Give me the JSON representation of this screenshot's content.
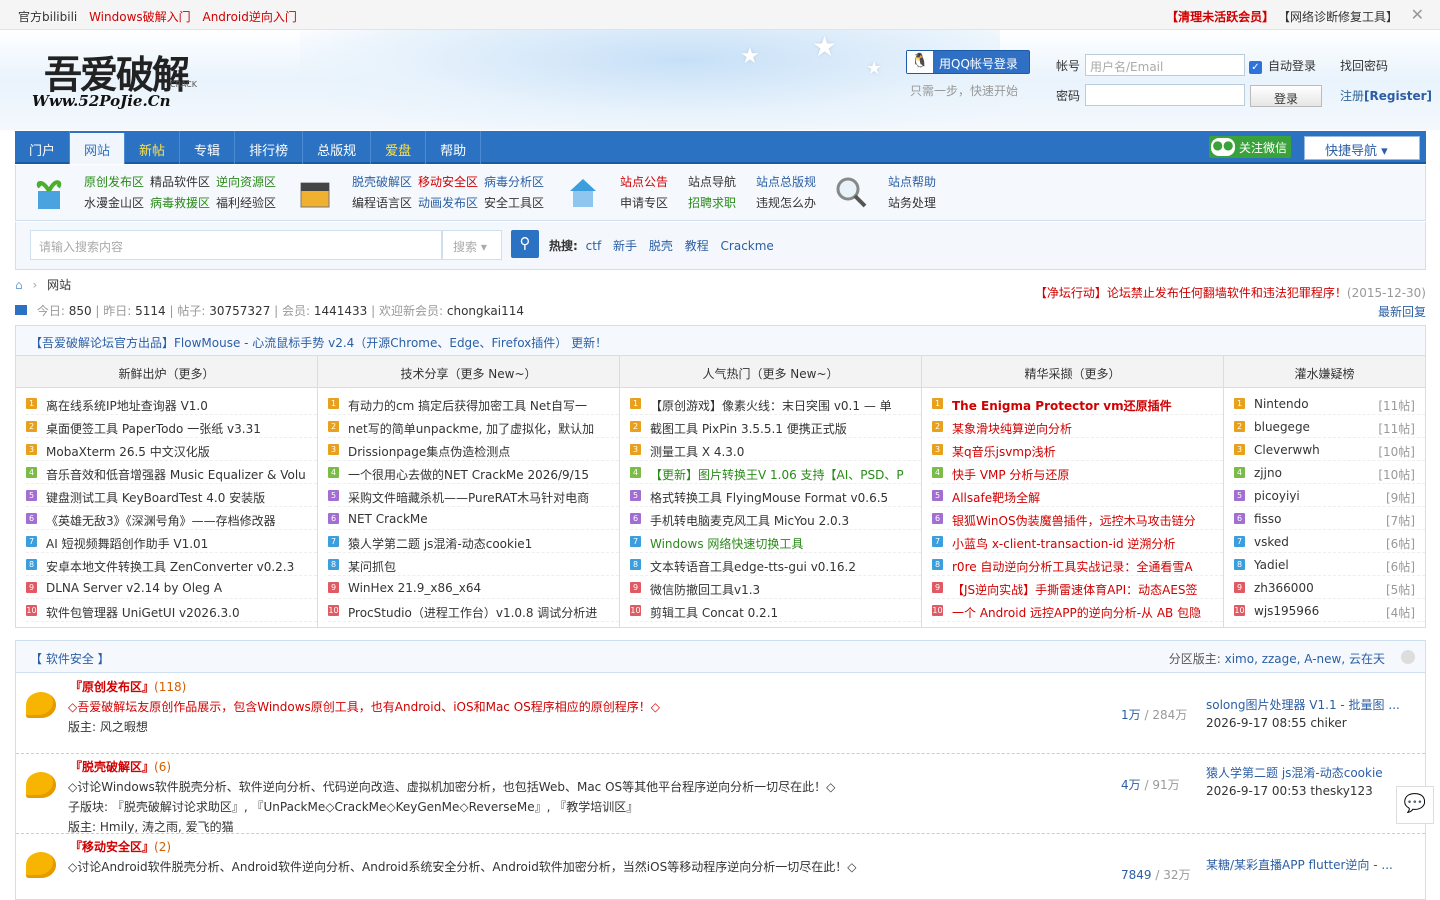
{
  "topbar": {
    "left": [
      "官方bilibili",
      "Windows破解入门",
      "Android逆向入门"
    ],
    "right1": "【清理未活跃会员】",
    "right2": "【网络诊断修复工具】",
    "close": "✕"
  },
  "header": {
    "logo_cn": "吾爱破解",
    "logo_crack": "CRACK",
    "logo_url": "Www.52PoJie.Cn",
    "qq_login": "用QQ帐号登录",
    "qq_sub": "只需一步，快速开始",
    "account_label": "帐号",
    "account_placeholder": "用户名/Email",
    "auto_login": "自动登录",
    "find_pwd": "找回密码",
    "pwd_label": "密码",
    "login_button": "登录",
    "register": "注册",
    "register_en": "[Register]"
  },
  "nav": {
    "items": [
      "门户",
      "网站",
      "新帖",
      "专辑",
      "排行榜",
      "总版规",
      "爱盘",
      "帮助"
    ],
    "wechat": "关注微信",
    "quick": "快捷导航"
  },
  "sublinks": {
    "g1r1": [
      "原创发布区",
      "精品软件区",
      "逆向资源区"
    ],
    "g1r2": [
      "水漫金山区",
      "病毒救援区",
      "福利经验区"
    ],
    "g2r1": [
      "脱壳破解区",
      "移动安全区",
      "病毒分析区"
    ],
    "g2r2": [
      "编程语言区",
      "动画发布区",
      "安全工具区"
    ],
    "g3r1": [
      "站点公告",
      "站点导航",
      "站点总版规"
    ],
    "g3r2": [
      "申请专区",
      "招聘求职",
      "违规怎么办"
    ],
    "g4r1": [
      "站点帮助"
    ],
    "g4r2": [
      "站务处理"
    ]
  },
  "search": {
    "placeholder": "请输入搜索内容",
    "select": "搜索",
    "hot_label": "热搜:",
    "hot": [
      "ctf",
      "新手",
      "脱壳",
      "教程",
      "Crackme"
    ]
  },
  "crumb": "网站",
  "stats": {
    "today_l": "今日:",
    "today": "850",
    "yest_l": "昨日:",
    "yest": "5114",
    "posts_l": "帖子:",
    "posts": "30757327",
    "members_l": "会员:",
    "members": "1441433",
    "welcome_l": "欢迎新会员:",
    "welcome": "chongkai114"
  },
  "notice": {
    "text": "【净坛行动】论坛禁止发布任何翻墙软件和违法犯罪程序！",
    "date": "(2015-12-30)"
  },
  "latest": "最新回复",
  "announce": "【吾爱破解论坛官方出品】FlowMouse - 心流鼠标手势 v2.4（开源Chrome、Edge、Firefox插件） 更新！",
  "columns": [
    {
      "head": "新鲜出炉（更多）",
      "items": [
        "离在线系统IP地址查询器 V1.0",
        "桌面便签工具 PaperTodo 一张纸 v3.31",
        "MobaXterm 26.5 中文汉化版",
        "音乐音效和低音增强器 Music Equalizer & Volu",
        "键盘测试工具 KeyBoardTest 4.0 安装版",
        "《英雄无敌3》《深渊号角》——存档修改器",
        "AI 短视频舞蹈创作助手 V1.01",
        "安卓本地文件转换工具 ZenConverter v0.2.3",
        "DLNA Server v2.14 by Oleg A",
        "软件包管理器 UniGetUI v2026.3.0"
      ]
    },
    {
      "head": "技术分享（更多 New~）",
      "items": [
        "有动力的cm 搞定后获得加密工具 Net自写一",
        "net写的简单unpackme, 加了虚拟化，默认加",
        "Drissionpage集点伪造检测点",
        "一个很用心去做的NET CrackMe 2026/9/15",
        "采购文件暗藏杀机——PureRAT木马针对电商",
        "NET CrackMe",
        "猿人学第二题 js混淆-动态cookie1",
        "某问抓包",
        "WinHex 21.9_x86_x64",
        "ProcStudio（进程工作台）v1.0.8 调试分析进"
      ]
    },
    {
      "head": "人气热门（更多 New~）",
      "items": [
        "【原创游戏】像素火线：末日突围 v0.1 — 单",
        "截图工具 PixPin 3.5.5.1 便携正式版",
        "测量工具 X 4.3.0",
        "【更新】图片转换王V 1.06 支持【AI、PSD、P",
        "格式转换工具 FlyingMouse Format v0.6.5",
        "手机转电脑麦克风工具 MicYou 2.0.3",
        "Windows 网络快速切换工具",
        "文本转语音工具edge-tts-gui v0.16.2",
        "微信防撤回工具v1.3",
        "剪辑工具 Concat 0.2.1"
      ]
    },
    {
      "head": "精华采撷（更多）",
      "items": [
        "The Enigma Protector vm还原插件",
        "某象滑块纯算逆向分析",
        "某q音乐jsvmp浅析",
        "快手 VMP 分析与还原",
        "Allsafe靶场全解",
        "银狐WinOS伪装魔兽插件，远控木马攻击链分",
        "小蓝鸟 x-client-transaction-id 逆溯分析",
        "r0re 自动逆向分析工具实战记录：全通看雪A",
        "【JS逆向实战】手撕雷速体育API：动态AES签",
        "一个 Android 远控APP的逆向分析-从 AB 包隐"
      ]
    },
    {
      "head": "灌水嫌疑榜",
      "items": [
        "Nintendo",
        "bluegege",
        "Cleverwwh",
        "zjjno",
        "picoyiyi",
        "fisso",
        "vsked",
        "Yadiel",
        "zh366000",
        "wjs195966"
      ],
      "counts": [
        "[11帖]",
        "[11帖]",
        "[10帖]",
        "[10帖]",
        "[9帖]",
        "[7帖]",
        "[6帖]",
        "[6帖]",
        "[5帖]",
        "[4帖]"
      ]
    }
  ],
  "section": {
    "title": "【 软件安全 】",
    "mod_label": "分区版主:",
    "mods": "ximo, zzage, A-new, 云在天",
    "forums": [
      {
        "title": "『原创发布区』",
        "count": "(118)",
        "desc": "◇吾爱破解坛友原创作品展示，包含Windows原创工具，也有Android、iOS和Mac OS程序相应的原创程序！◇",
        "line3": "版主: 风之暇想",
        "line4": "",
        "stats": "1万",
        "stats2": " / 284万",
        "last": "solong图片处理器 V1.1 - 批量图 ...",
        "last_time": "2026-9-17 08:55 chiker"
      },
      {
        "title": "『脱壳破解区』",
        "count": "(6)",
        "desc": "◇讨论Windows软件脱壳分析、软件逆向分析、代码逆向改造、虚拟机加密分析，也包括Web、Mac OS等其他平台程序逆向分析一切尽在此！◇",
        "line3": "子版块: 『脱壳破解讨论求助区』, 『UnPackMe◇CrackMe◇KeyGenMe◇ReverseMe』, 『教学培训区』",
        "line4": "版主: Hmily, 涛之雨, 爱飞的猫",
        "stats": "4万",
        "stats2": " / 91万",
        "last": "猿人学第二题 js混淆-动态cookie",
        "last_time": "2026-9-17 00:53 thesky123"
      },
      {
        "title": "『移动安全区』",
        "count": "(2)",
        "desc": "◇讨论Android软件脱壳分析、Android软件逆向分析、Android系统安全分析、Android软件加密分析，当然iOS等移动程序逆向分析一切尽在此！◇",
        "line3": "",
        "line4": "",
        "stats": "7849",
        "stats2": " / 32万",
        "last": "某糖/某彩直播APP flutter逆向 - ...",
        "last_time": ""
      }
    ]
  }
}
